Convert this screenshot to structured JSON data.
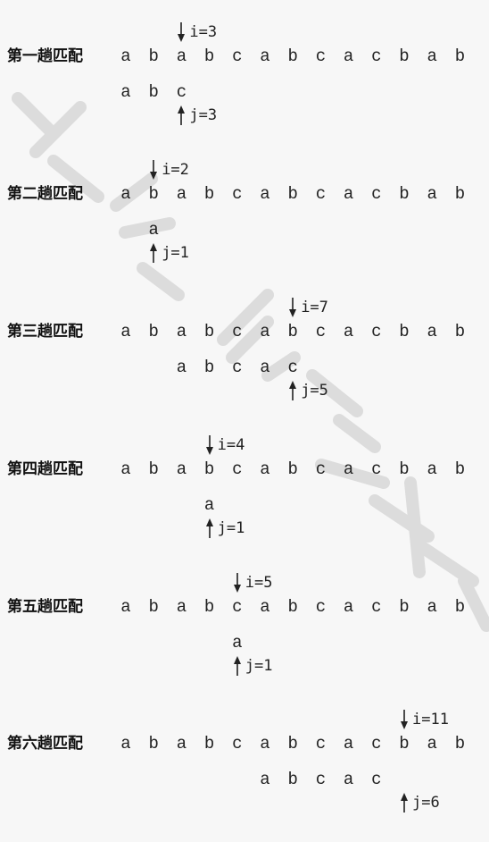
{
  "text": "ababcabcacbab",
  "pattern": "abcac",
  "label_suffix": "趟匹配",
  "passes": [
    {
      "label": "第一趟匹配",
      "i_text": "i=3",
      "j_text": "j=3",
      "i": 3,
      "j": 3,
      "pattern_shown": "abc"
    },
    {
      "label": "第二趟匹配",
      "i_text": "i=2",
      "j_text": "j=1",
      "i": 2,
      "j": 1,
      "pattern_shown": "a"
    },
    {
      "label": "第三趟匹配",
      "i_text": "i=7",
      "j_text": "j=5",
      "i": 7,
      "j": 5,
      "pattern_shown": "abcac"
    },
    {
      "label": "第四趟匹配",
      "i_text": "i=4",
      "j_text": "j=1",
      "i": 4,
      "j": 1,
      "pattern_shown": "a"
    },
    {
      "label": "第五趟匹配",
      "i_text": "i=5",
      "j_text": "j=1",
      "i": 5,
      "j": 1,
      "pattern_shown": "a"
    },
    {
      "label": "第六趟匹配",
      "i_text": "i=11",
      "j_text": "j=6",
      "i": 11,
      "j": 6,
      "pattern_shown": "abcac"
    }
  ],
  "watermark_text": "众号 考研"
}
